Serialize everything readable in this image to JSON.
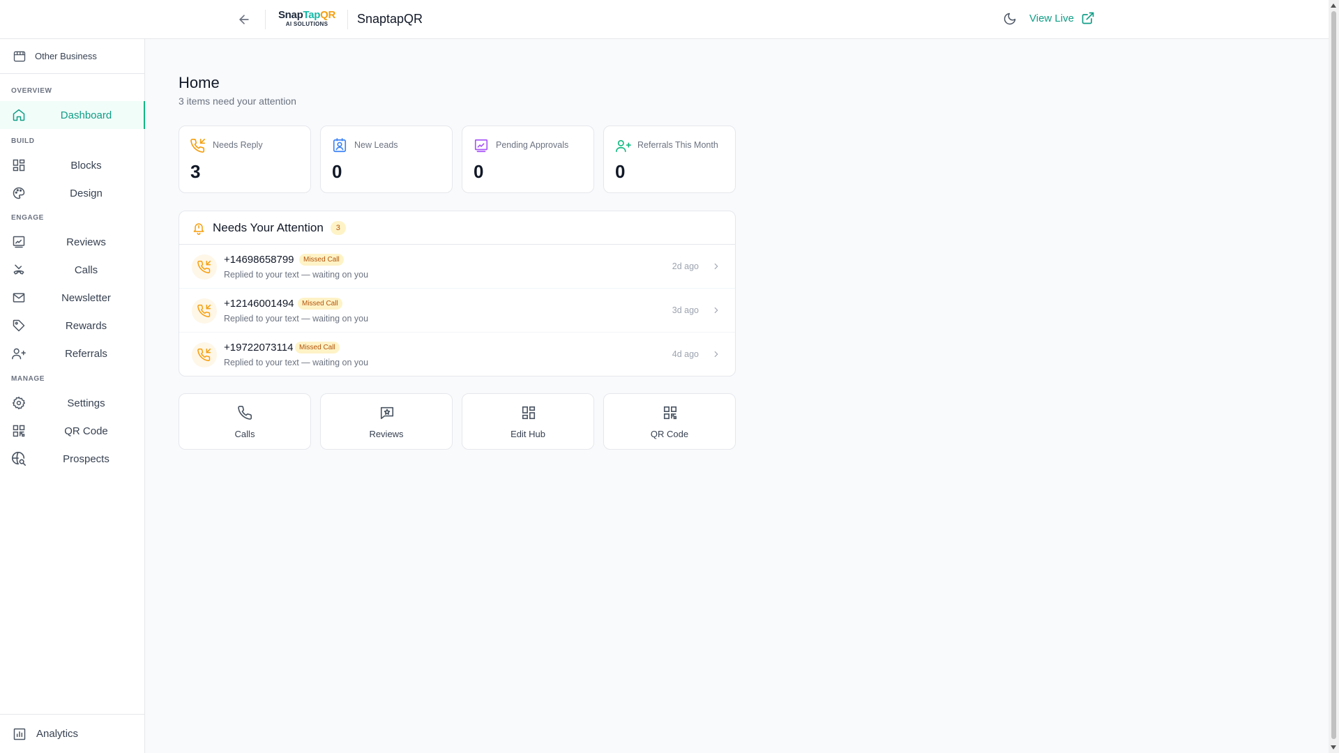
{
  "header": {
    "logo": {
      "snap": "Snap",
      "tap": "Tap",
      "qr": "QR",
      "sub": "AI SOLUTIONS"
    },
    "brand_name": "SnaptapQR",
    "view_live_label": "View Live"
  },
  "sidebar": {
    "business_name": "Other Business",
    "sections": {
      "overview": "OVERVIEW",
      "build": "BUILD",
      "engage": "ENGAGE",
      "manage": "MANAGE"
    },
    "items": {
      "dashboard": "Dashboard",
      "blocks": "Blocks",
      "design": "Design",
      "reviews": "Reviews",
      "calls": "Calls",
      "newsletter": "Newsletter",
      "rewards": "Rewards",
      "referrals": "Referrals",
      "settings": "Settings",
      "qr_code": "QR Code",
      "prospects": "Prospects"
    },
    "analytics_label": "Analytics"
  },
  "main": {
    "title": "Home",
    "subtitle": "3 items need your attention",
    "stats": [
      {
        "label": "Needs Reply",
        "value": "3",
        "icon": "phone-incoming-icon",
        "color": "#f59e0b"
      },
      {
        "label": "New Leads",
        "value": "0",
        "icon": "contact-icon",
        "color": "#3b82f6"
      },
      {
        "label": "Pending Approvals",
        "value": "0",
        "icon": "review-pending-icon",
        "color": "#a855f7"
      },
      {
        "label": "Referrals This Month",
        "value": "0",
        "icon": "user-plus-icon",
        "color": "#10b981"
      }
    ],
    "attention": {
      "title": "Needs Your Attention",
      "count": "3",
      "rows": [
        {
          "phone": "+14698658799",
          "badge": "Missed Call",
          "desc": "Replied to your text — waiting on you",
          "time": "2d ago"
        },
        {
          "phone": "+12146001494",
          "badge": "Missed Call",
          "desc": "Replied to your text — waiting on you",
          "time": "3d ago"
        },
        {
          "phone": "+19722073114",
          "badge": "Missed Call",
          "desc": "Replied to your text — waiting on you",
          "time": "4d ago"
        }
      ]
    },
    "quick_actions": [
      {
        "label": "Calls",
        "icon": "phone-icon"
      },
      {
        "label": "Reviews",
        "icon": "message-star-icon"
      },
      {
        "label": "Edit Hub",
        "icon": "grid-icon"
      },
      {
        "label": "QR Code",
        "icon": "qr-code-icon"
      }
    ]
  },
  "colors": {
    "accent": "#0f9d86",
    "warning": "#f59e0b",
    "badge_bg": "#fef3c7",
    "badge_text": "#b45309"
  }
}
